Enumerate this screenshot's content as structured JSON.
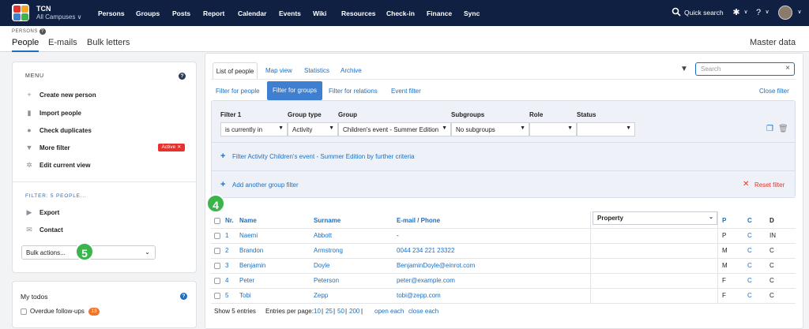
{
  "topbar": {
    "org_name": "TCN",
    "campus": "All Campuses ∨",
    "nav": [
      "Persons",
      "Groups",
      "Posts",
      "Report",
      "Calendar",
      "Events",
      "Wiki",
      "Resources",
      "Check-in",
      "Finance",
      "Sync"
    ],
    "quick_search": "Quick search",
    "help_label": "?"
  },
  "subheader": {
    "breadcrumb": "PERSONS",
    "tabs": [
      "People",
      "E-mails",
      "Bulk letters"
    ],
    "master_data": "Master data"
  },
  "sidebar": {
    "menu_title": "MENU",
    "items": [
      {
        "label": "Create new person",
        "icon": "plus-icon"
      },
      {
        "label": "Import people",
        "icon": "file-import-icon"
      },
      {
        "label": "Check duplicates",
        "icon": "users-icon"
      },
      {
        "label": "More filter",
        "icon": "filter-icon"
      },
      {
        "label": "Edit current view",
        "icon": "gear-icon"
      }
    ],
    "active_badge": "Active ✕",
    "filter_title": "FILTER: 5 PEOPLE...",
    "actions": [
      {
        "label": "Export",
        "icon": "export-icon"
      },
      {
        "label": "Contact",
        "icon": "envelope-icon"
      }
    ],
    "bulk_actions": "Bulk actions...",
    "annotation_5": "5"
  },
  "todos": {
    "title": "My todos",
    "item": "Overdue follow-ups",
    "count": "13"
  },
  "main": {
    "view_tabs": [
      "List of people",
      "Map view",
      "Statistics",
      "Archive"
    ],
    "search_placeholder": "Search",
    "filter_tabs": [
      "Filter for people",
      "Filter for groups",
      "Filter for relations",
      "Event filter"
    ],
    "close_filter": "Close filter",
    "filter_headers": [
      "Filter 1",
      "Group type",
      "Group",
      "Subgroups",
      "Role",
      "Status"
    ],
    "filter_values": [
      "is currently in",
      "Activity",
      "Children's event - Summer Edition",
      "No subgroups",
      "",
      ""
    ],
    "further_criteria": "Filter Activity Children's event - Summer Edition by further criteria",
    "add_group_filter": "Add another group filter",
    "reset_filter": "Reset filter",
    "annotation_4": "4"
  },
  "table": {
    "headers": [
      "Nr.",
      "Name",
      "Surname",
      "E-mail / Phone",
      "Property",
      "P",
      "C",
      "D"
    ],
    "rows": [
      {
        "nr": "1",
        "name": "Naemi",
        "surname": "Abbott",
        "contact": "-",
        "p": "P",
        "c": "C",
        "d": "IN"
      },
      {
        "nr": "2",
        "name": "Brandon",
        "surname": "Armstrong",
        "contact": "0044 234 221 23322",
        "p": "M",
        "c": "C",
        "d": "C"
      },
      {
        "nr": "3",
        "name": "Benjamin",
        "surname": "Doyle",
        "contact": "BenjaminDoyle@einrot.com",
        "p": "M",
        "c": "C",
        "d": "C"
      },
      {
        "nr": "4",
        "name": "Peter",
        "surname": "Peterson",
        "contact": "peter@example.com",
        "p": "F",
        "c": "C",
        "d": "C"
      },
      {
        "nr": "5",
        "name": "Tobi",
        "surname": "Zepp",
        "contact": "tobi@zepp.com",
        "p": "F",
        "c": "C",
        "d": "C"
      }
    ],
    "footer": {
      "show": "Show 5 entries",
      "per_page_label": "Entries per page:",
      "per_page": [
        "10",
        "25",
        "50",
        "200"
      ],
      "open_each": "open each",
      "close_each": "close each"
    }
  }
}
